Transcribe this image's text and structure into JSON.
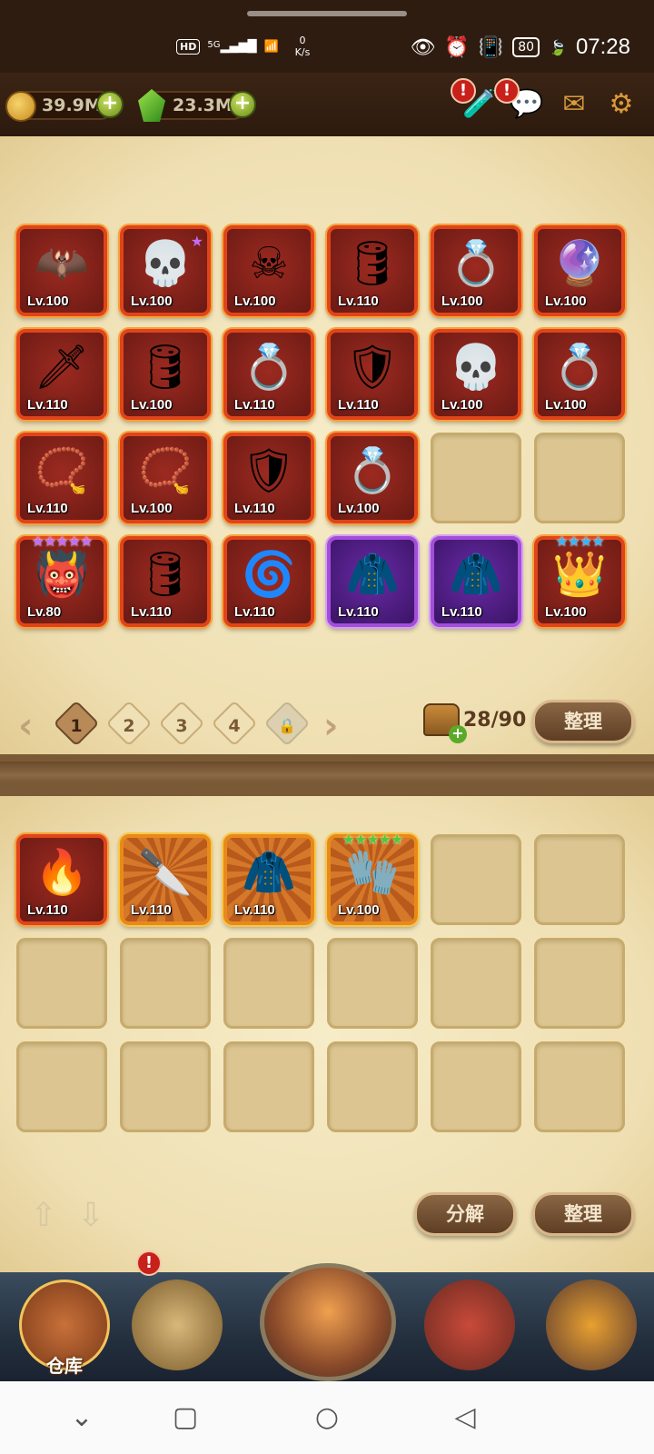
{
  "status_bar": {
    "hd": "HD",
    "signal": "5G",
    "net_speed": "0",
    "net_unit": "K/s",
    "battery": "80",
    "time": "07:28"
  },
  "resources": {
    "gold": "39.9M",
    "gems": "23.3M"
  },
  "upper_items": [
    {
      "level": "Lv.100",
      "icon": "dark-wings-cloak-icon",
      "glyph": "🦇",
      "frame": "red"
    },
    {
      "level": "Lv.100",
      "icon": "skull-helmet-icon",
      "glyph": "💀",
      "frame": "red",
      "corner_star": "★"
    },
    {
      "level": "Lv.100",
      "icon": "skeleton-coffin-icon",
      "glyph": "☠",
      "frame": "red"
    },
    {
      "level": "Lv.110",
      "icon": "acid-drum-icon",
      "glyph": "🛢",
      "frame": "red"
    },
    {
      "level": "Lv.100",
      "icon": "eye-ring-icon",
      "glyph": "💍",
      "frame": "red"
    },
    {
      "level": "Lv.100",
      "icon": "winged-orb-amulet-icon",
      "glyph": "🔮",
      "frame": "red"
    },
    {
      "level": "Lv.110",
      "icon": "curved-blade-icon",
      "glyph": "🗡",
      "frame": "red"
    },
    {
      "level": "Lv.100",
      "icon": "acid-drum-icon",
      "glyph": "🛢",
      "frame": "red"
    },
    {
      "level": "Lv.110",
      "icon": "amethyst-ring-icon",
      "glyph": "💍",
      "frame": "red"
    },
    {
      "level": "Lv.110",
      "icon": "dark-armor-icon",
      "glyph": "🛡",
      "frame": "red"
    },
    {
      "level": "Lv.100",
      "icon": "hooded-skull-icon",
      "glyph": "💀",
      "frame": "red"
    },
    {
      "level": "Lv.100",
      "icon": "amethyst-ring-icon",
      "glyph": "💍",
      "frame": "red"
    },
    {
      "level": "Lv.110",
      "icon": "ruby-necklace-icon",
      "glyph": "📿",
      "frame": "red"
    },
    {
      "level": "Lv.100",
      "icon": "ruby-pendant-icon",
      "glyph": "📿",
      "frame": "red"
    },
    {
      "level": "Lv.110",
      "icon": "stone-armor-icon",
      "glyph": "🛡",
      "frame": "red"
    },
    {
      "level": "Lv.100",
      "icon": "eye-ring-icon",
      "glyph": "💍",
      "frame": "red"
    },
    null,
    null,
    {
      "level": "Lv.80",
      "icon": "demon-mask-helmet-icon",
      "glyph": "👹",
      "frame": "red",
      "stars": "★★★★★",
      "star_color": "purple"
    },
    {
      "level": "Lv.110",
      "icon": "acid-drum-icon",
      "glyph": "🛢",
      "frame": "red"
    },
    {
      "level": "Lv.110",
      "icon": "vortex-gauntlet-icon",
      "glyph": "🌀",
      "frame": "red"
    },
    {
      "level": "Lv.110",
      "icon": "shadow-cloak-icon",
      "glyph": "🧥",
      "frame": "purple"
    },
    {
      "level": "Lv.110",
      "icon": "shadow-cloak-icon",
      "glyph": "🧥",
      "frame": "purple"
    },
    {
      "level": "Lv.100",
      "icon": "jeweled-crown-helmet-icon",
      "glyph": "👑",
      "frame": "red",
      "stars": "★★★★",
      "star_color": "blue"
    }
  ],
  "pager": {
    "pages": [
      "1",
      "2",
      "3",
      "4"
    ],
    "active_page": "1",
    "lock_glyph": "🔒",
    "prev_glyph": "‹",
    "next_glyph": "›",
    "capacity": "28/90",
    "sort_label": "整理"
  },
  "lower_items": [
    {
      "level": "Lv.110",
      "icon": "flame-spear-icon",
      "glyph": "🔥",
      "frame": "red"
    },
    {
      "level": "Lv.110",
      "icon": "dagger-icon",
      "glyph": "🔪",
      "frame": "orange"
    },
    {
      "level": "Lv.110",
      "icon": "shadow-cloak-icon",
      "glyph": "🧥",
      "frame": "orange"
    },
    {
      "level": "Lv.100",
      "icon": "eye-glove-icon",
      "glyph": "🧤",
      "frame": "orange",
      "stars": "★★★★★",
      "star_color": "green"
    },
    null,
    null,
    null,
    null,
    null,
    null,
    null,
    null,
    null,
    null,
    null,
    null,
    null,
    null
  ],
  "lower_controls": {
    "up_glyph": "⇧",
    "down_glyph": "⇩",
    "decompose_label": "分解",
    "sort_label": "整理"
  },
  "bottom_nav": {
    "warehouse_label": "仓库"
  },
  "alerts": {
    "mark": "!"
  },
  "colors": {
    "accent_red": "#e0441a",
    "parchment": "#f2e4bc",
    "button_brown": "#6e4c30"
  }
}
